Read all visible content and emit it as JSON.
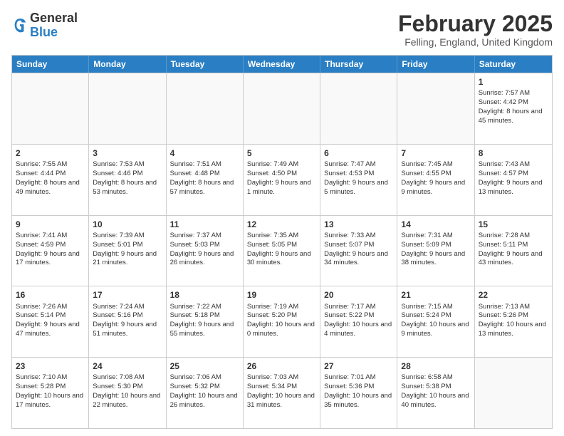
{
  "logo": {
    "general": "General",
    "blue": "Blue"
  },
  "title": "February 2025",
  "subtitle": "Felling, England, United Kingdom",
  "headers": [
    "Sunday",
    "Monday",
    "Tuesday",
    "Wednesday",
    "Thursday",
    "Friday",
    "Saturday"
  ],
  "weeks": [
    [
      {
        "day": "",
        "info": "",
        "empty": true
      },
      {
        "day": "",
        "info": "",
        "empty": true
      },
      {
        "day": "",
        "info": "",
        "empty": true
      },
      {
        "day": "",
        "info": "",
        "empty": true
      },
      {
        "day": "",
        "info": "",
        "empty": true
      },
      {
        "day": "",
        "info": "",
        "empty": true
      },
      {
        "day": "1",
        "info": "Sunrise: 7:57 AM\nSunset: 4:42 PM\nDaylight: 8 hours and 45 minutes.",
        "empty": false
      }
    ],
    [
      {
        "day": "2",
        "info": "Sunrise: 7:55 AM\nSunset: 4:44 PM\nDaylight: 8 hours and 49 minutes.",
        "empty": false
      },
      {
        "day": "3",
        "info": "Sunrise: 7:53 AM\nSunset: 4:46 PM\nDaylight: 8 hours and 53 minutes.",
        "empty": false
      },
      {
        "day": "4",
        "info": "Sunrise: 7:51 AM\nSunset: 4:48 PM\nDaylight: 8 hours and 57 minutes.",
        "empty": false
      },
      {
        "day": "5",
        "info": "Sunrise: 7:49 AM\nSunset: 4:50 PM\nDaylight: 9 hours and 1 minute.",
        "empty": false
      },
      {
        "day": "6",
        "info": "Sunrise: 7:47 AM\nSunset: 4:53 PM\nDaylight: 9 hours and 5 minutes.",
        "empty": false
      },
      {
        "day": "7",
        "info": "Sunrise: 7:45 AM\nSunset: 4:55 PM\nDaylight: 9 hours and 9 minutes.",
        "empty": false
      },
      {
        "day": "8",
        "info": "Sunrise: 7:43 AM\nSunset: 4:57 PM\nDaylight: 9 hours and 13 minutes.",
        "empty": false
      }
    ],
    [
      {
        "day": "9",
        "info": "Sunrise: 7:41 AM\nSunset: 4:59 PM\nDaylight: 9 hours and 17 minutes.",
        "empty": false
      },
      {
        "day": "10",
        "info": "Sunrise: 7:39 AM\nSunset: 5:01 PM\nDaylight: 9 hours and 21 minutes.",
        "empty": false
      },
      {
        "day": "11",
        "info": "Sunrise: 7:37 AM\nSunset: 5:03 PM\nDaylight: 9 hours and 26 minutes.",
        "empty": false
      },
      {
        "day": "12",
        "info": "Sunrise: 7:35 AM\nSunset: 5:05 PM\nDaylight: 9 hours and 30 minutes.",
        "empty": false
      },
      {
        "day": "13",
        "info": "Sunrise: 7:33 AM\nSunset: 5:07 PM\nDaylight: 9 hours and 34 minutes.",
        "empty": false
      },
      {
        "day": "14",
        "info": "Sunrise: 7:31 AM\nSunset: 5:09 PM\nDaylight: 9 hours and 38 minutes.",
        "empty": false
      },
      {
        "day": "15",
        "info": "Sunrise: 7:28 AM\nSunset: 5:11 PM\nDaylight: 9 hours and 43 minutes.",
        "empty": false
      }
    ],
    [
      {
        "day": "16",
        "info": "Sunrise: 7:26 AM\nSunset: 5:14 PM\nDaylight: 9 hours and 47 minutes.",
        "empty": false
      },
      {
        "day": "17",
        "info": "Sunrise: 7:24 AM\nSunset: 5:16 PM\nDaylight: 9 hours and 51 minutes.",
        "empty": false
      },
      {
        "day": "18",
        "info": "Sunrise: 7:22 AM\nSunset: 5:18 PM\nDaylight: 9 hours and 55 minutes.",
        "empty": false
      },
      {
        "day": "19",
        "info": "Sunrise: 7:19 AM\nSunset: 5:20 PM\nDaylight: 10 hours and 0 minutes.",
        "empty": false
      },
      {
        "day": "20",
        "info": "Sunrise: 7:17 AM\nSunset: 5:22 PM\nDaylight: 10 hours and 4 minutes.",
        "empty": false
      },
      {
        "day": "21",
        "info": "Sunrise: 7:15 AM\nSunset: 5:24 PM\nDaylight: 10 hours and 9 minutes.",
        "empty": false
      },
      {
        "day": "22",
        "info": "Sunrise: 7:13 AM\nSunset: 5:26 PM\nDaylight: 10 hours and 13 minutes.",
        "empty": false
      }
    ],
    [
      {
        "day": "23",
        "info": "Sunrise: 7:10 AM\nSunset: 5:28 PM\nDaylight: 10 hours and 17 minutes.",
        "empty": false
      },
      {
        "day": "24",
        "info": "Sunrise: 7:08 AM\nSunset: 5:30 PM\nDaylight: 10 hours and 22 minutes.",
        "empty": false
      },
      {
        "day": "25",
        "info": "Sunrise: 7:06 AM\nSunset: 5:32 PM\nDaylight: 10 hours and 26 minutes.",
        "empty": false
      },
      {
        "day": "26",
        "info": "Sunrise: 7:03 AM\nSunset: 5:34 PM\nDaylight: 10 hours and 31 minutes.",
        "empty": false
      },
      {
        "day": "27",
        "info": "Sunrise: 7:01 AM\nSunset: 5:36 PM\nDaylight: 10 hours and 35 minutes.",
        "empty": false
      },
      {
        "day": "28",
        "info": "Sunrise: 6:58 AM\nSunset: 5:38 PM\nDaylight: 10 hours and 40 minutes.",
        "empty": false
      },
      {
        "day": "",
        "info": "",
        "empty": true
      }
    ]
  ]
}
